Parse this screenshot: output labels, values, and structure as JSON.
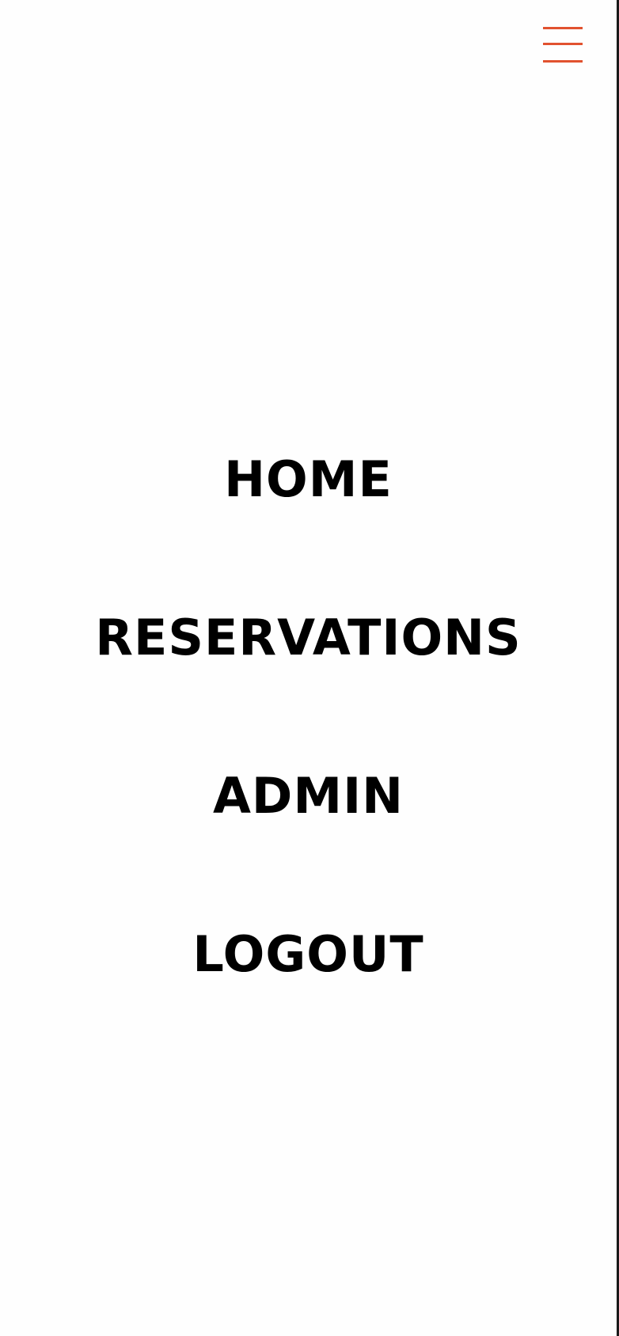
{
  "menu": {
    "toggle_icon": "hamburger-menu-icon",
    "accent_color": "#e1522f",
    "items": [
      {
        "label": "HOME"
      },
      {
        "label": "RESERVATIONS"
      },
      {
        "label": "ADMIN"
      },
      {
        "label": "LOGOUT"
      }
    ]
  }
}
